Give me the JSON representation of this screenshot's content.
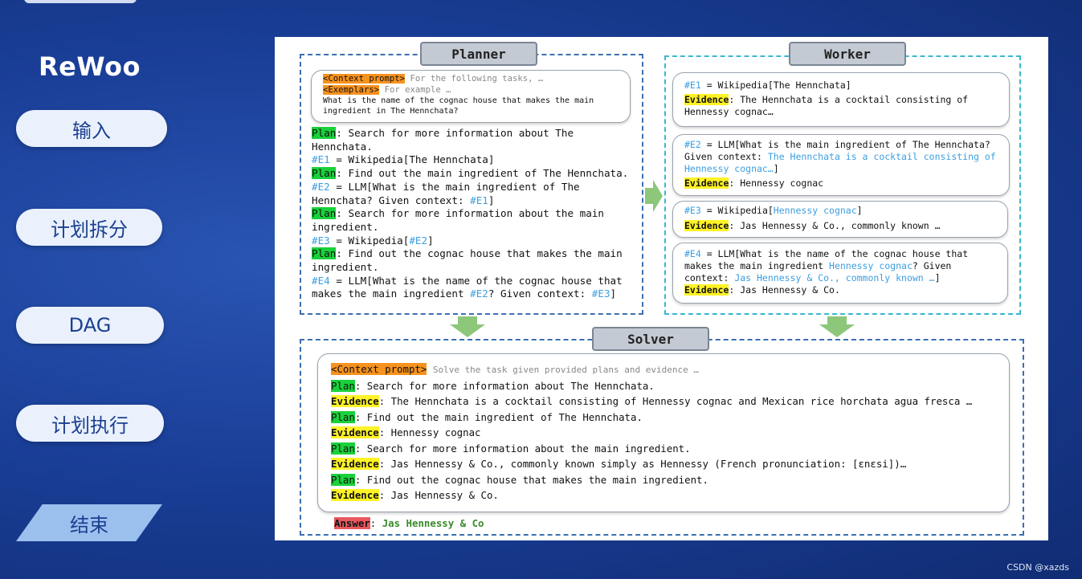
{
  "app_title": "ReWoo",
  "nav": [
    "输入",
    "计划拆分",
    "DAG",
    "计划执行",
    "结束"
  ],
  "watermark": "CSDN @xazds",
  "planner": {
    "header": "Planner",
    "context_tag": "<Context prompt>",
    "context_text": "For the following tasks, …",
    "exemplars_tag": "<Exemplars>",
    "exemplars_text": "For example …",
    "question_1": "What is the name of the cognac house that makes the main",
    "question_2": "ingredient in The Hennchata?",
    "lines": {
      "plan1_label": "Plan",
      "plan1_a": ": Search for more information about The",
      "plan1_b": "Hennchata.",
      "e1_id": "#E1",
      "e1_rest": " = Wikipedia[The Hennchata]",
      "plan2_label": "Plan",
      "plan2": ": Find out the main ingredient of The Hennchata.",
      "e2_id": "#E2",
      "e2_a": " = LLM[What is the main ingredient of The",
      "e2_b": "Hennchata? Given context: ",
      "e2_ref": "#E1",
      "e2_end": "]",
      "plan3_label": "Plan",
      "plan3_a": ": Search for more information about the main",
      "plan3_b": "ingredient.",
      "e3_id": "#E3",
      "e3_rest": " = Wikipedia[",
      "e3_ref": "#E2",
      "e3_end": "]",
      "plan4_label": "Plan",
      "plan4_a": ": Find out the cognac house that makes the main",
      "plan4_b": "ingredient.",
      "e4_id": "#E4",
      "e4_a": " = LLM[What is the name of the cognac house that",
      "e4_b1": "makes the main ingredient ",
      "e4_ref1": "#E2",
      "e4_b2": "? Given context: ",
      "e4_ref2": "#E3",
      "e4_end": "]"
    }
  },
  "worker": {
    "header": "Worker",
    "card1": {
      "id": "#E1",
      "rest": " = Wikipedia[The Hennchata]",
      "ev_label": "Evidence",
      "ev_a": ": The Hennchata is a cocktail consisting of",
      "ev_b": "Hennessy cognac…"
    },
    "card2": {
      "id": "#E2",
      "rest": " = LLM[What is the main ingredient of The Hennchata?",
      "ctx_label": "Given context: ",
      "ctx_blue_a": "The Hennchata is a cocktail consisting of",
      "ctx_blue_b": "Hennessy cognac…",
      "ctx_end": "]",
      "ev_label": "Evidence",
      "ev": ": Hennessy cognac"
    },
    "card3": {
      "id": "#E3",
      "rest": " = Wikipedia[",
      "blue": "Hennessy cognac",
      "end": "]",
      "ev_label": "Evidence",
      "ev": ": Jas Hennessy & Co., commonly known …"
    },
    "card4": {
      "id": "#E4",
      "rest": " = LLM[What is the name of the cognac house that",
      "b1": "makes the main ingredient ",
      "blue1": "Hennessy cognac",
      "b2": "? Given",
      "c1": "context: ",
      "blue2": "Jas Hennessy & Co., commonly known …",
      "c2": "]",
      "ev_label": "Evidence",
      "ev": ": Jas Hennessy & Co."
    }
  },
  "solver": {
    "header": "Solver",
    "context_tag": "<Context prompt>",
    "context_text": "Solve the task given provided plans and evidence …",
    "plan_label": "Plan",
    "evidence_label": "Evidence",
    "rows": [
      {
        "kind": "plan",
        "text": ": Search for more information about The Hennchata."
      },
      {
        "kind": "evidence",
        "text": ": The Hennchata is a cocktail consisting of Hennessy cognac and Mexican rice horchata agua fresca …"
      },
      {
        "kind": "plan",
        "text": ": Find out the main ingredient of The Hennchata."
      },
      {
        "kind": "evidence",
        "text": ": Hennessy cognac"
      },
      {
        "kind": "plan",
        "text": ": Search for more information about the main ingredient."
      },
      {
        "kind": "evidence",
        "text": ": Jas Hennessy & Co., commonly known simply as Hennessy (French pronunciation: [ɛnɛsi])…"
      },
      {
        "kind": "plan",
        "text": ": Find out the cognac house that makes the main ingredient."
      },
      {
        "kind": "evidence",
        "text": ": Jas Hennessy & Co."
      }
    ],
    "answer_label": "Answer",
    "answer_colon": ": ",
    "answer": "Jas Hennessy & Co"
  },
  "colors": {
    "background": "#1a3f98",
    "nav_pill": "#eaf1fd",
    "nav_active": "#9cc0ee",
    "tag_orange": "#f7921e",
    "plan_green": "#19d13b",
    "evidence_yellow": "#fff226",
    "answer_red": "#e8585e",
    "ref_blue": "#3b9ee0",
    "arrow_green": "#8cc77a"
  }
}
